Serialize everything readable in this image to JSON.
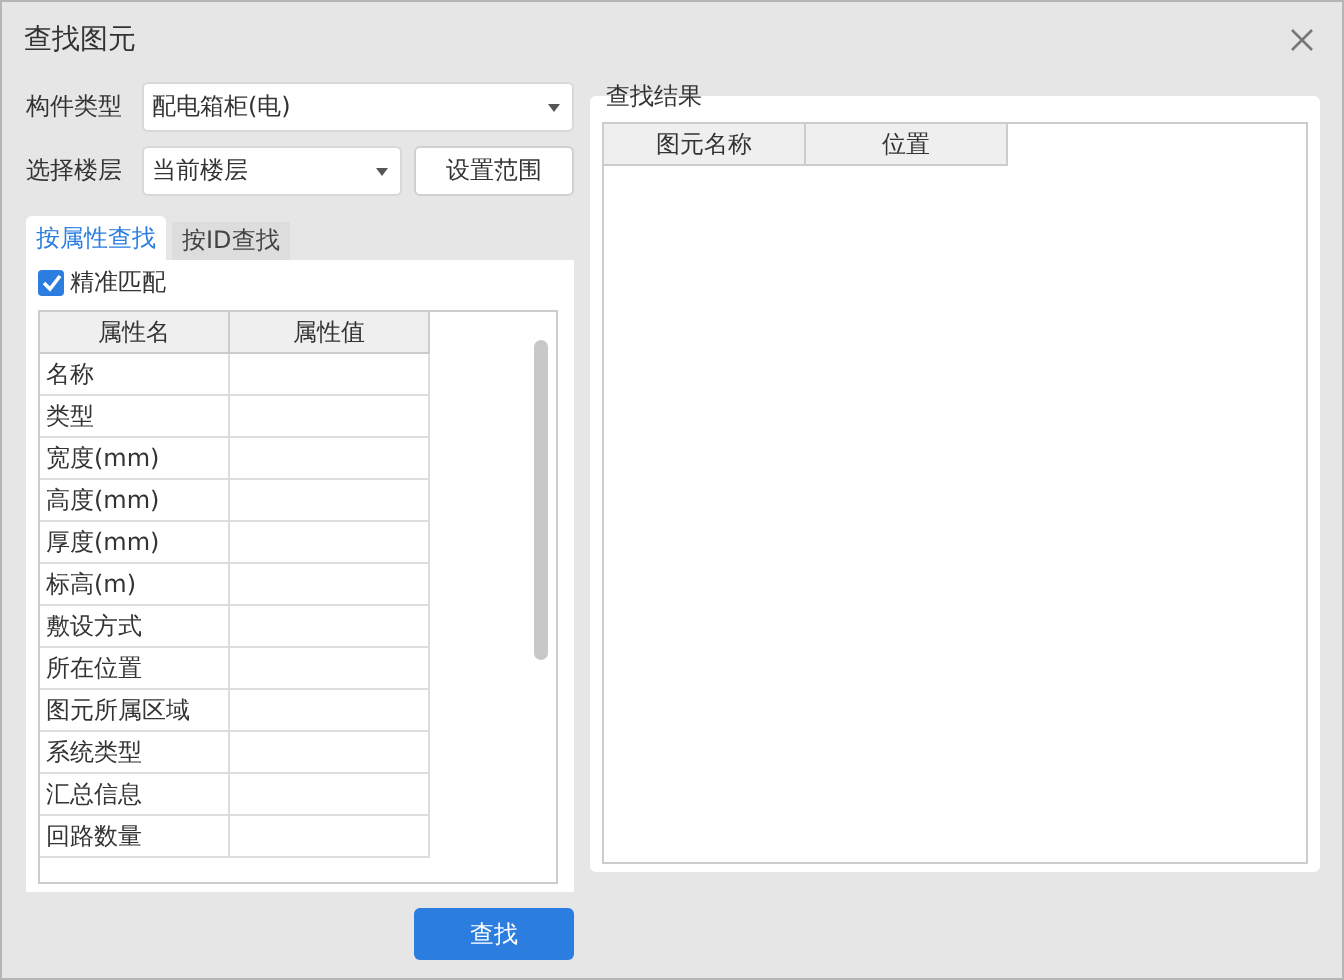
{
  "window": {
    "title": "查找图元"
  },
  "fields": [
    {
      "label": "构件类型",
      "value": "配电箱柜(电)"
    },
    {
      "label": "选择楼层",
      "value": "当前楼层"
    }
  ],
  "range_button": "设置范围",
  "tabs": [
    {
      "label": "按属性查找",
      "selected": true
    },
    {
      "label": "按ID查找",
      "selected": false
    }
  ],
  "exact_match": {
    "label": "精准匹配",
    "checked": true
  },
  "property_table": {
    "columns": [
      "属性名",
      "属性值"
    ],
    "rows": [
      "名称",
      "类型",
      "宽度(mm)",
      "高度(mm)",
      "厚度(mm)",
      "标高(m)",
      "敷设方式",
      "所在位置",
      "图元所属区域",
      "系统类型",
      "汇总信息",
      "回路数量"
    ]
  },
  "results": {
    "title": "查找结果",
    "columns": [
      "图元名称",
      "位置"
    ]
  },
  "search_button": "查找"
}
